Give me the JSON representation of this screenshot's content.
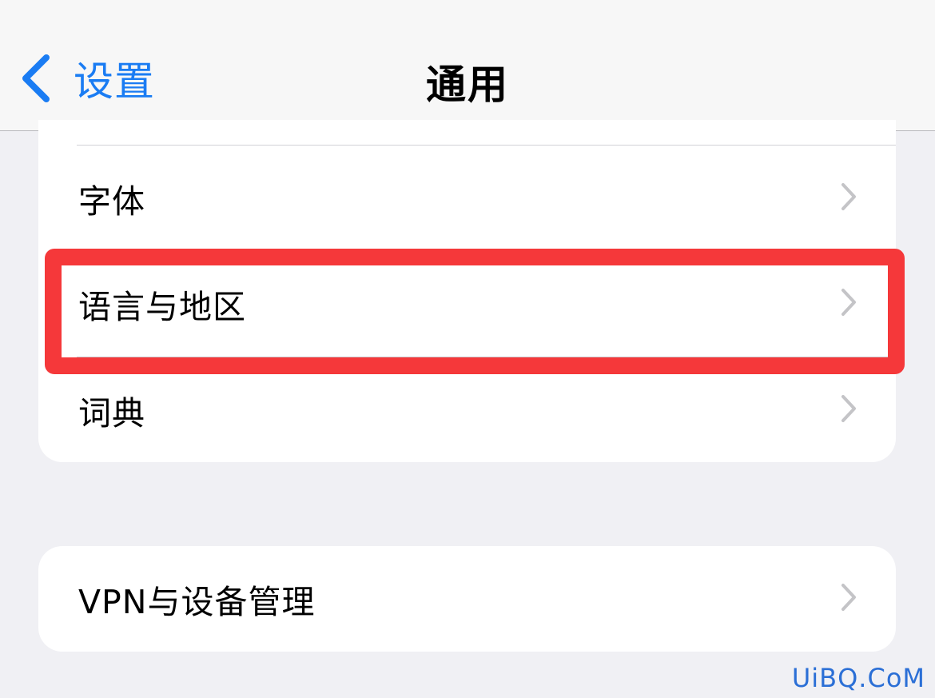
{
  "nav": {
    "back_label": "设置",
    "title": "通用"
  },
  "rows": [
    {
      "label": "字体"
    },
    {
      "label": "语言与地区"
    },
    {
      "label": "词典"
    }
  ],
  "section2": {
    "label": "VPN与设备管理"
  },
  "watermark": "UiBQ.CoM",
  "colors": {
    "accent": "#1a7cf3",
    "highlight": "#f5383a",
    "background": "#f0f0f4",
    "chevron": "#c4c4c7"
  },
  "icons": {
    "back": "chevron-left-icon",
    "row_arrow": "chevron-right-icon"
  }
}
